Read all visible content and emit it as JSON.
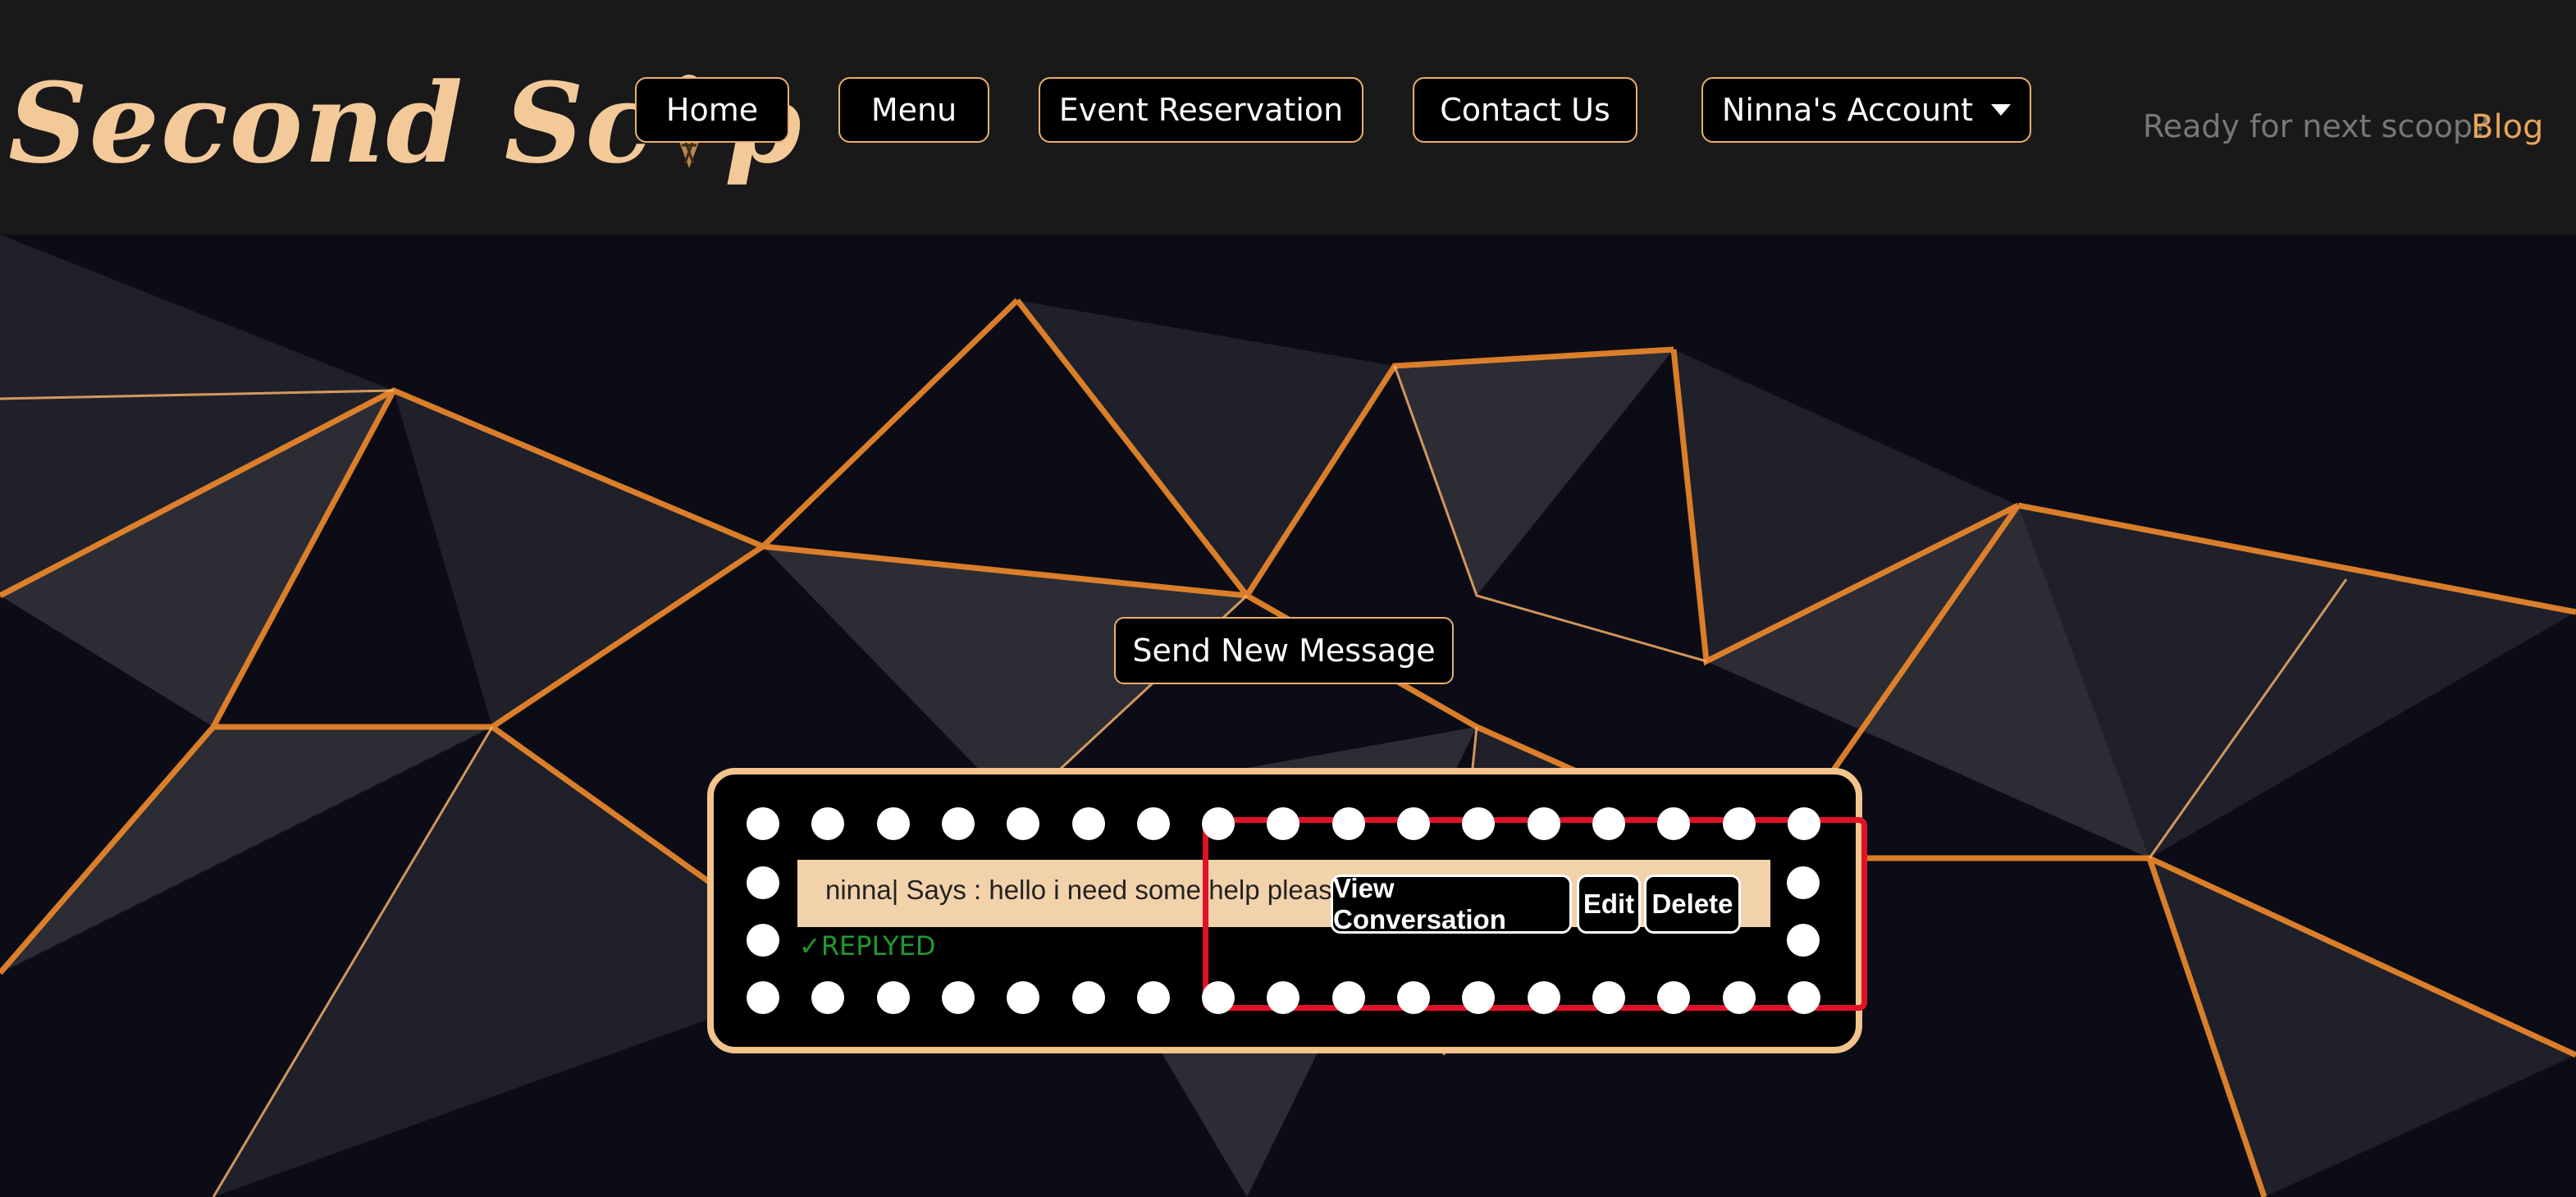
{
  "header": {
    "logo_text_left": "Second Sc",
    "logo_text_right": "p",
    "nav": [
      {
        "label": "Home"
      },
      {
        "label": "Menu"
      },
      {
        "label": "Event Reservation"
      },
      {
        "label": "Contact Us"
      }
    ],
    "account_label": "Ninna's Account",
    "tagline": "Ready for next scoop?",
    "blog_label": "Blog"
  },
  "main": {
    "send_button_label": "Send New Message",
    "message": {
      "text": "ninna| Says : hello i need some help please",
      "status": "✓REPLYED",
      "actions": {
        "view": "View Conversation",
        "edit": "Edit",
        "delete": "Delete"
      }
    }
  },
  "colors": {
    "accent": "#e9b06d",
    "card_border": "#f3c48c",
    "highlight": "#e11227",
    "status": "#1f9a2f"
  }
}
